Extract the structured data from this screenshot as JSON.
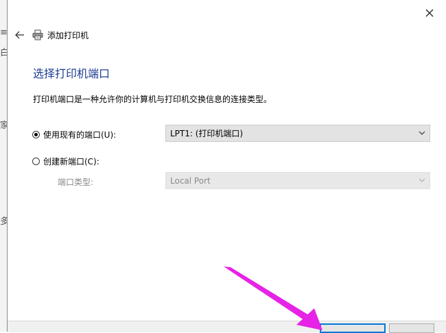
{
  "background_fragments": [
    "≡",
    "白",
    "家",
    "多"
  ],
  "window": {
    "title": "添加打印机",
    "close_icon": "close-icon",
    "back_icon": "back-arrow-icon",
    "printer_icon": "printer-icon"
  },
  "main": {
    "heading": "选择打印机端口",
    "description": "打印机端口是一种允许你的计算机与打印机交换信息的连接类型。"
  },
  "options": {
    "existing_port": {
      "label": "使用现有的端口(U):",
      "checked": true,
      "selected_value": "LPT1: (打印机端口)"
    },
    "new_port": {
      "label": "创建新端口(C):",
      "checked": false,
      "type_label": "端口类型:",
      "type_value": "Local Port"
    }
  },
  "colors": {
    "heading": "#1e3d8f",
    "annotation_arrow": "#e623e6",
    "focus_border": "#0078d7"
  }
}
